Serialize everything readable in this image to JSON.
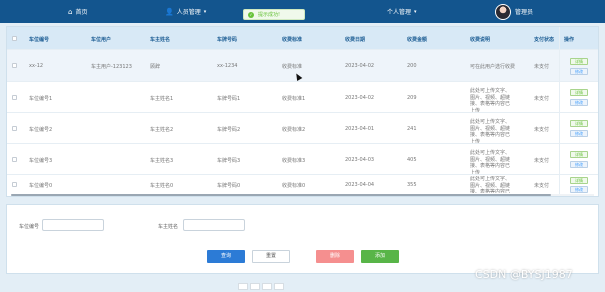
{
  "nav": {
    "home": "首页",
    "people": "人员管理",
    "personal": "个人管理",
    "username": "管理员",
    "toast": "提示成功!"
  },
  "table": {
    "headers": [
      "车位编号",
      "车位用户",
      "车主姓名",
      "车牌号码",
      "收费标准",
      "收费日期",
      "收费金额",
      "收费说明",
      "支付状态",
      "操作"
    ],
    "rows": [
      {
        "no": "xx-12",
        "user": "车主用户-123123",
        "owner": "顾辞",
        "plate": "xx-1234",
        "standard": "收费标准",
        "date": "2023-04-02",
        "amount": "200",
        "desc": "可在此用户选行收费",
        "status": "未支付"
      },
      {
        "no": "车位编号1",
        "user": "",
        "owner": "车主姓名1",
        "plate": "车牌号码1",
        "standard": "收费标准1",
        "date": "2023-04-02",
        "amount": "209",
        "desc": "此处可上传文字、图片、视频、超链接、表格等内容已上传",
        "status": "未支付"
      },
      {
        "no": "车位编号2",
        "user": "",
        "owner": "车主姓名2",
        "plate": "车牌号码2",
        "standard": "收费标准2",
        "date": "2023-04-01",
        "amount": "241",
        "desc": "此处可上传文字、图片、视频、超链接、表格等内容已上传",
        "status": "未支付"
      },
      {
        "no": "车位编号3",
        "user": "",
        "owner": "车主姓名3",
        "plate": "车牌号码3",
        "standard": "收费标准3",
        "date": "2023-04-03",
        "amount": "405",
        "desc": "此处可上传文字、图片、视频、超链接、表格等内容已上传",
        "status": "未支付"
      },
      {
        "no": "车位编号0",
        "user": "",
        "owner": "车主姓名0",
        "plate": "车牌号码0",
        "standard": "收费标准0",
        "date": "2023-04-04",
        "amount": "355",
        "desc": "此处可上传文字、图片、视频、超链接、表格等内容已上传",
        "status": "未支付"
      }
    ],
    "detail_label": "详情",
    "edit_label": "修改"
  },
  "search": {
    "parking_no_label": "车位编号",
    "owner_label": "车主姓名",
    "parking_no_value": "",
    "owner_value": "",
    "query": "查询",
    "reset": "重置",
    "delete": "删除",
    "add": "添加"
  },
  "watermark": "CSDN @BYSJ1987",
  "colors": {
    "topbar": "#13558e",
    "header_bg": "#d8e9f6",
    "query": "#2c7bd6",
    "delete": "#f58f8f",
    "add": "#58b548",
    "success": "#67c23a"
  }
}
